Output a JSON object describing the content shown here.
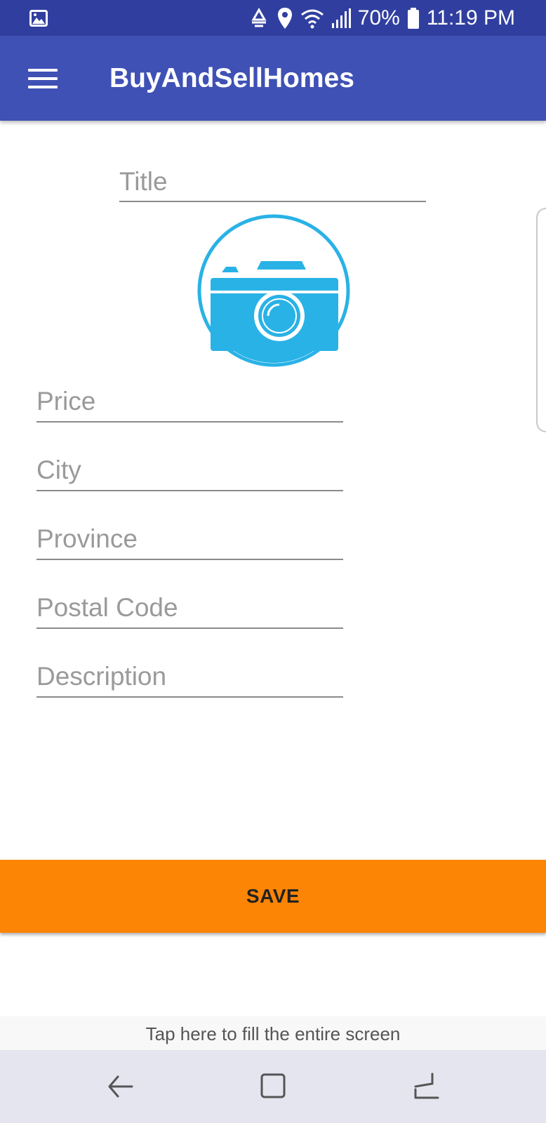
{
  "status_bar": {
    "battery": "70%",
    "time": "11:19 PM",
    "icons": [
      "image-notification-icon",
      "data-saver-icon",
      "location-icon",
      "wifi-icon",
      "signal-icon",
      "battery-icon"
    ]
  },
  "app_bar": {
    "title": "BuyAndSellHomes",
    "menu_icon": "hamburger-menu-icon"
  },
  "form": {
    "title_placeholder": "Title",
    "title_value": "",
    "camera_icon": "camera-icon",
    "price_placeholder": "Price",
    "price_value": "",
    "city_placeholder": "City",
    "city_value": "",
    "province_placeholder": "Province",
    "province_value": "",
    "postal_code_placeholder": "Postal Code",
    "postal_code_value": "",
    "description_placeholder": "Description",
    "description_value": ""
  },
  "actions": {
    "save_label": "SAVE"
  },
  "banner": {
    "fill_screen_text": "Tap here to fill the entire screen"
  },
  "nav_bar": {
    "icons": [
      "back-icon",
      "home-icon",
      "recents-icon"
    ]
  },
  "colors": {
    "status_bar": "#303f9f",
    "app_bar": "#3f51b5",
    "camera": "#29b2e6",
    "save_button": "#fd8505"
  }
}
